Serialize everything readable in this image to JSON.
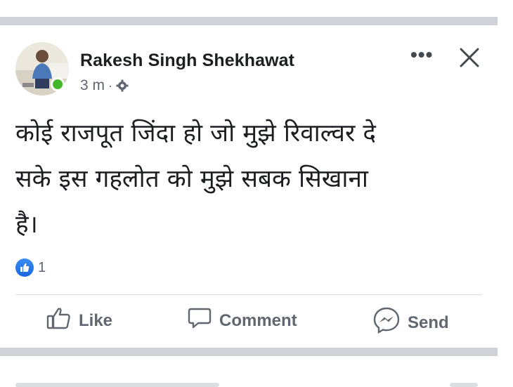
{
  "post": {
    "author": "Rakesh Singh Shekhawat",
    "time": "3 m",
    "meta_separator": "·",
    "body_lines": [
      "कोई राजपूत जिंदा हो जो मुझे रिवाल्वर दे",
      "सके इस गहलोत को मुझे सबक सिखाना",
      "है।"
    ],
    "more_label": "•••",
    "reaction_count": "1"
  },
  "actions": {
    "like": "Like",
    "comment": "Comment",
    "send": "Send"
  },
  "icons": {
    "online": "online-status-dot",
    "privacy": "gear-icon",
    "reaction": "like-reaction-icon",
    "close": "close-icon",
    "more": "more-options-icon"
  },
  "colors": {
    "online": "#42b72a",
    "like_blue": "#1877f2",
    "text": "#1c1e21",
    "muted": "#606770",
    "separator": "#cfd2d6"
  }
}
